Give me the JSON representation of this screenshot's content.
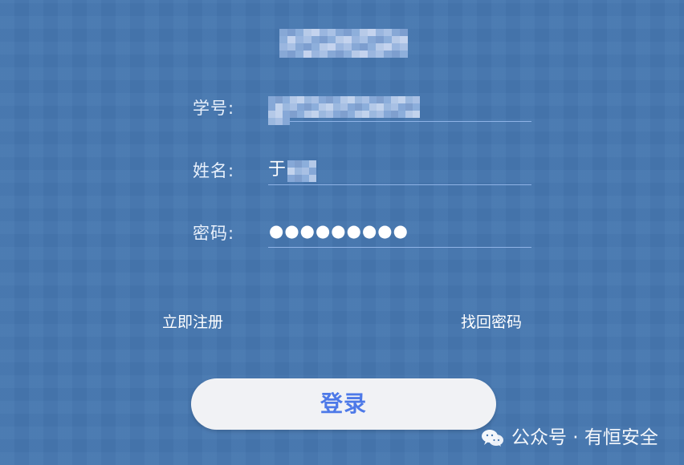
{
  "form": {
    "fields": [
      {
        "label": "学号:",
        "value": ""
      },
      {
        "label": "姓名:",
        "value": "于"
      },
      {
        "label": "密码:",
        "value": "●●●●●●●●●"
      }
    ]
  },
  "links": {
    "register": "立即注册",
    "forgot_password": "找回密码"
  },
  "button": {
    "login": "登录"
  },
  "watermark": {
    "text": "公众号 · 有恒安全",
    "icon": "wechat-icon"
  },
  "colors": {
    "background": "#4677b0",
    "input_underline": "#8fb3e6",
    "button_background": "#f1f2f5",
    "button_text": "#4d79e8"
  }
}
